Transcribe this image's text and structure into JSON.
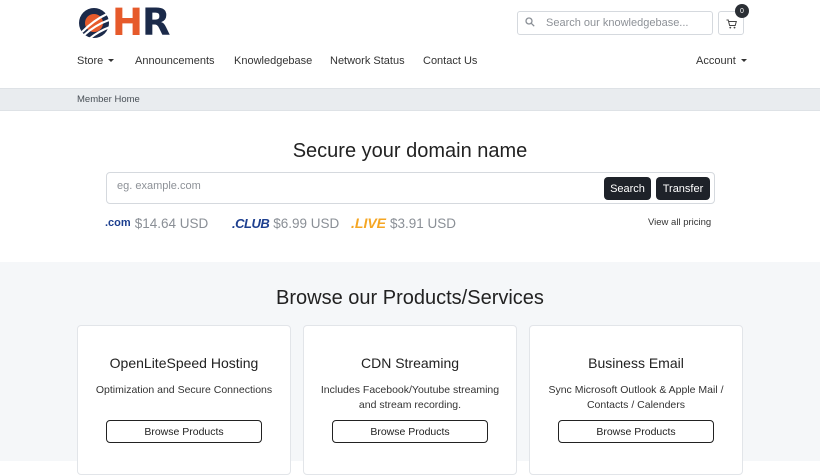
{
  "brand": {
    "logo_letters": {
      "o": "O",
      "h": "H",
      "r": "R"
    },
    "colors": {
      "navy": "#1b2a4a",
      "orange": "#e65a2b"
    }
  },
  "header": {
    "search_placeholder": "Search our knowledgebase...",
    "search_icon": "search-icon",
    "cart_icon": "cart-icon",
    "cart_count": "0"
  },
  "nav": {
    "store": "Store",
    "announcements": "Announcements",
    "knowledgebase": "Knowledgebase",
    "network_status": "Network Status",
    "contact_us": "Contact Us",
    "account": "Account"
  },
  "breadcrumb": {
    "current": "Member Home"
  },
  "domain": {
    "title": "Secure your domain name",
    "placeholder": "eg. example.com",
    "search_label": "Search",
    "transfer_label": "Transfer",
    "view_all_pricing": "View all pricing",
    "tlds": [
      {
        "name": ".com",
        "price": "$14.64 USD"
      },
      {
        "name": ".CLUB",
        "price": "$6.99 USD"
      },
      {
        "name": ".LIVE",
        "price": "$3.91 USD"
      }
    ]
  },
  "products": {
    "title": "Browse our Products/Services",
    "cards": [
      {
        "title": "OpenLiteSpeed Hosting",
        "desc": "Optimization and Secure Connections",
        "button": "Browse Products"
      },
      {
        "title": "CDN Streaming",
        "desc": "Includes Facebook/Youtube streaming and stream recording.",
        "button": "Browse Products"
      },
      {
        "title": "Business Email",
        "desc": "Sync Microsoft Outlook & Apple Mail / Contacts / Calenders",
        "button": "Browse Products"
      }
    ]
  },
  "colors": {
    "dark_button": "#1e2229",
    "section_bg": "#f5f7f9",
    "breadcrumb_bg": "#e9ecef"
  }
}
